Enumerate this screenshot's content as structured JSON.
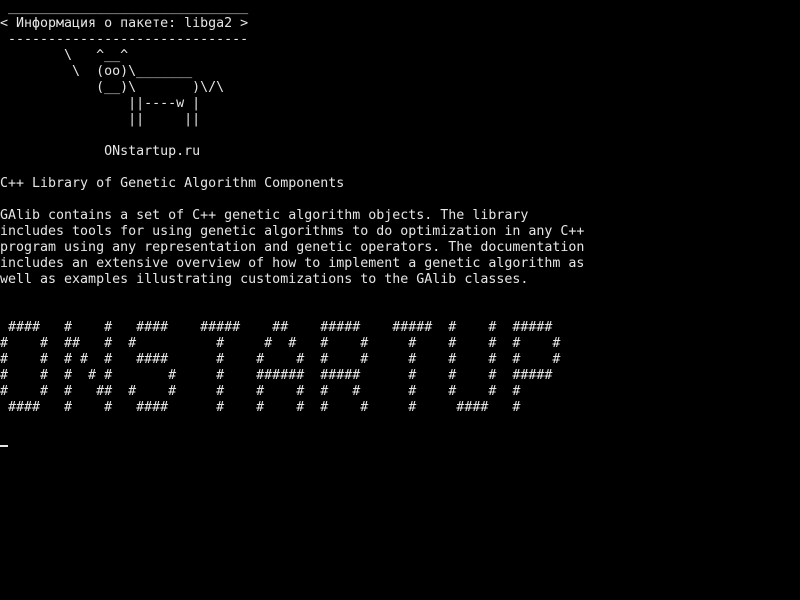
{
  "terminal": {
    "colors": {
      "background": "#000000",
      "foreground": "#e6e6e6"
    },
    "bubble": {
      "top_border": " ______________________________",
      "text": "< Информация о пакете: libga2 >",
      "bottom_border": " ------------------------------"
    },
    "cow": [
      "        \\   ^__^",
      "         \\  (oo)\\_______",
      "            (__)\\       )\\/\\",
      "                ||----w |",
      "                ||     ||"
    ],
    "site": "             ONstartup.ru",
    "title": "C++ Library of Genetic Algorithm Components",
    "description": [
      "GAlib contains a set of C++ genetic algorithm objects. The library",
      "includes tools for using genetic algorithms to do optimization in any C++",
      "program using any representation and genetic operators. The documentation",
      "includes an extensive overview of how to implement a genetic algorithm as",
      "well as examples illustrating customizations to the GAlib classes."
    ],
    "banner": [
      " ####   #    #   ####    #####    ##    #####    #####  #    #  #####",
      "#    #  ##   #  #          #     #  #   #    #     #    #    #  #    #",
      "#    #  # #  #   ####      #    #    #  #    #     #    #    #  #    #",
      "#    #  #  # #       #     #    ######  #####      #    #    #  #####",
      "#    #  #   ##  #    #     #    #    #  #   #      #    #    #  #",
      " ####   #    #   ####      #    #    #  #    #     #     ####   #"
    ],
    "cursor_icon": "block-cursor"
  }
}
